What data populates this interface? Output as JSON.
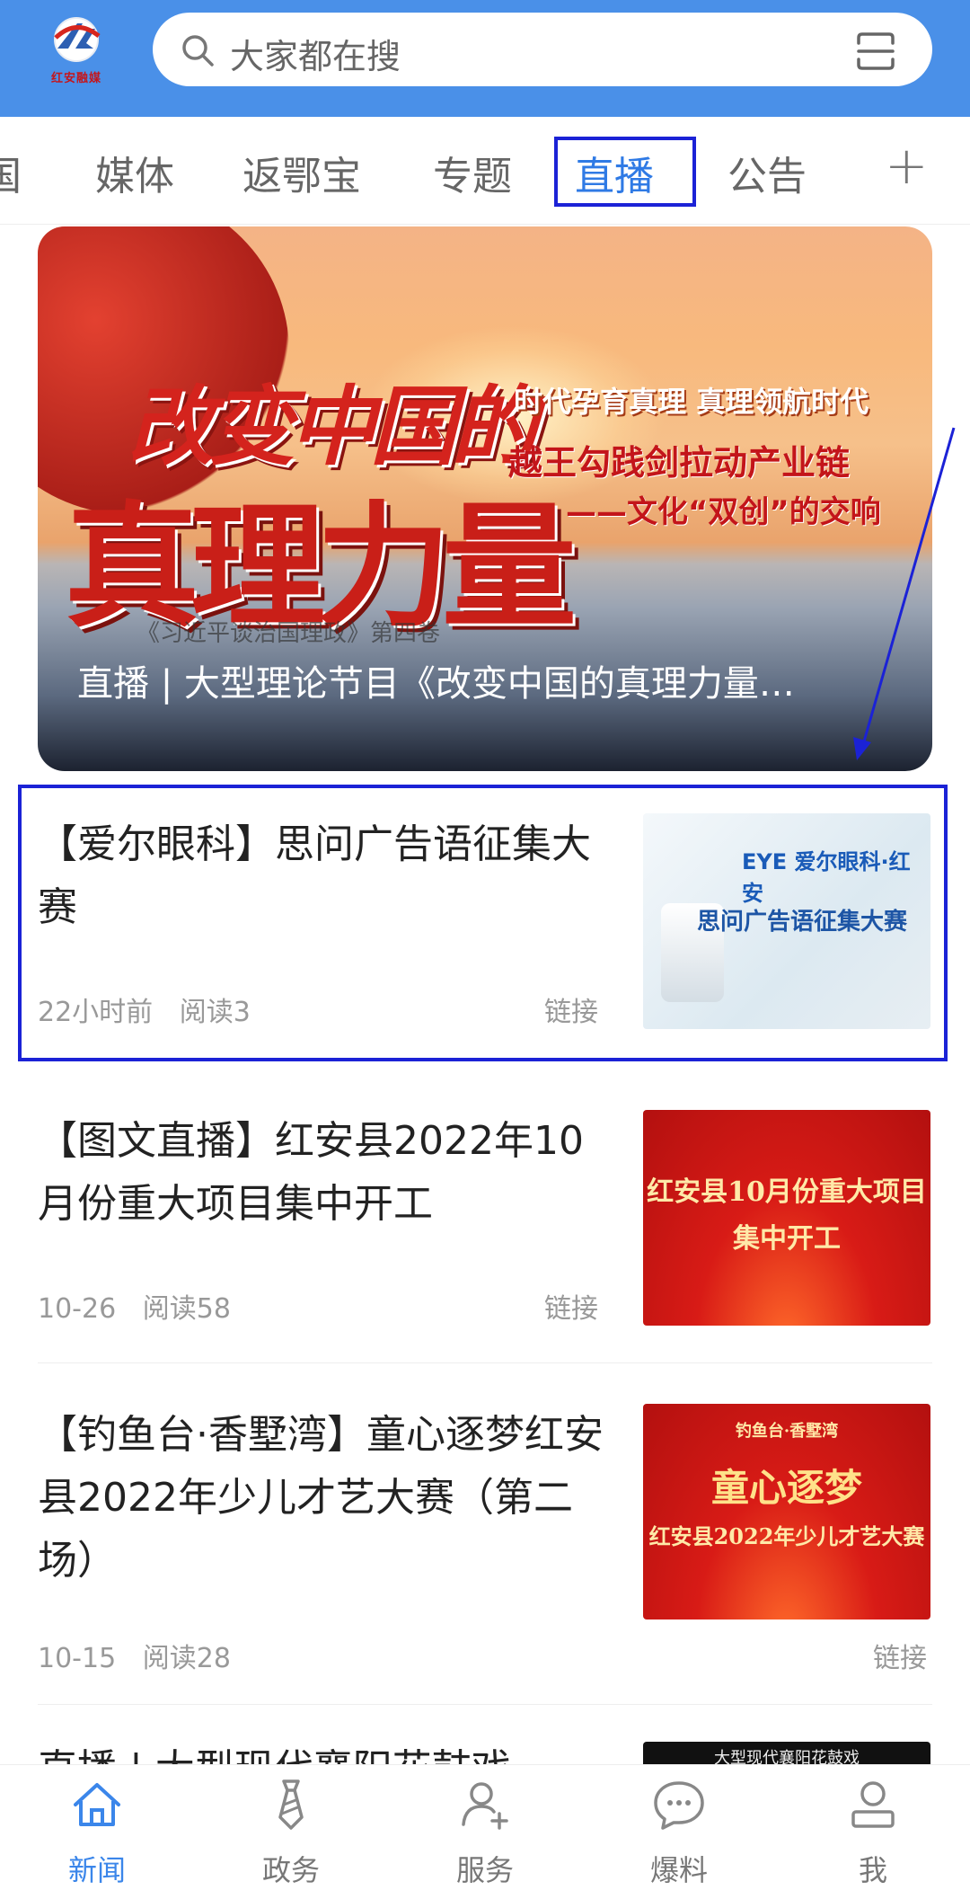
{
  "header": {
    "logo_text": "红安融媒",
    "search_placeholder": "大家都在搜"
  },
  "tabs": [
    {
      "label": "国",
      "active": false
    },
    {
      "label": "媒体",
      "active": false
    },
    {
      "label": "返鄂宝",
      "active": false
    },
    {
      "label": "专题",
      "active": false
    },
    {
      "label": "直播",
      "active": true
    },
    {
      "label": "公告",
      "active": false
    }
  ],
  "banner": {
    "headline_line1": "改变中国的",
    "headline_line2": "真理力量",
    "right_line1": "时代孕育真理 真理领航时代",
    "right_line2": "越王勾践剑拉动产业链",
    "right_line3": "——文化“双创”的交响",
    "sub_text": "《习近平谈治国理政》第四卷",
    "caption": "直播 | 大型理论节目《改变中国的真理力量…"
  },
  "news": [
    {
      "title": "【爱尔眼科】思问广告语征集大赛",
      "time": "22小时前",
      "reads": "阅读3",
      "link": "链接",
      "thumb_text1": "EYE 爱尔眼科·红安",
      "thumb_text2": "思问广告语征集大赛"
    },
    {
      "title": "【图文直播】红安县2022年10月份重大项目集中开工",
      "time": "10-26",
      "reads": "阅读58",
      "link": "链接",
      "thumb_text1": "红安县10月份重大项目",
      "thumb_text2": "集中开工"
    },
    {
      "title": "【钓鱼台·香墅湾】童心逐梦红安县2022年少儿才艺大赛（第二场）",
      "time": "10-15",
      "reads": "阅读28",
      "link": "链接",
      "thumb_text0": "钓鱼台·香墅湾",
      "thumb_text1": "童心逐梦",
      "thumb_text2": "红安县2022年少儿才艺大赛"
    },
    {
      "title": "直播 | 大型现代襄阳花鼓戏",
      "thumb_text1": "大型现代襄阳花鼓戏"
    }
  ],
  "bottom_nav": [
    {
      "label": "新闻",
      "icon": "home-icon",
      "active": true
    },
    {
      "label": "政务",
      "icon": "tie-icon",
      "active": false
    },
    {
      "label": "服务",
      "icon": "user-add-icon",
      "active": false
    },
    {
      "label": "爆料",
      "icon": "chat-icon",
      "active": false
    },
    {
      "label": "我",
      "icon": "profile-icon",
      "active": false
    }
  ],
  "colors": {
    "header_bg": "#4a90e8",
    "accent": "#2f7ae5",
    "highlight_box": "#1b22d6"
  }
}
